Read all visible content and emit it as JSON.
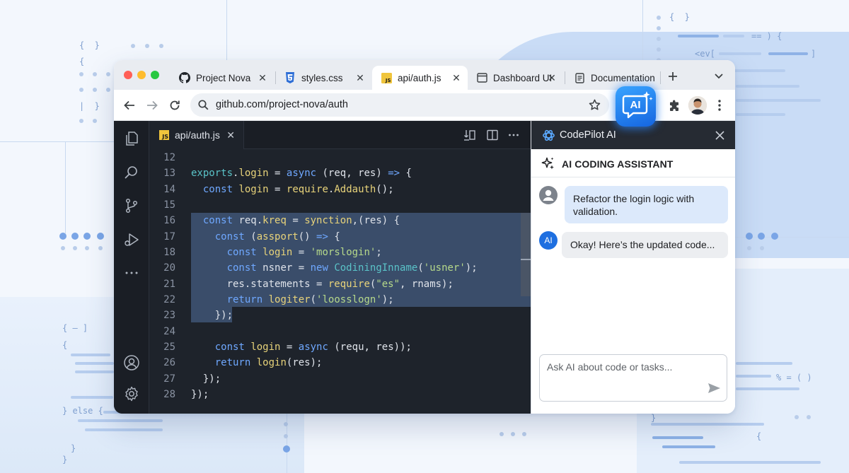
{
  "browser": {
    "tabs": [
      {
        "label": "Project Nova",
        "icon": "github-icon",
        "active": false
      },
      {
        "label": "styles.css",
        "icon": "css-icon",
        "active": false
      },
      {
        "label": "api/auth.js",
        "icon": "js-icon",
        "active": true
      },
      {
        "label": "Dashboard UI",
        "icon": "window-icon",
        "active": false
      },
      {
        "label": "Documentation",
        "icon": "document-icon",
        "active": false
      }
    ],
    "url": "github.com/project-nova/auth",
    "ai_badge_label": "AI"
  },
  "editor": {
    "tab_label": "api/auth.js",
    "js_badge": "JS",
    "lines": [
      {
        "n": "12",
        "tokens": []
      },
      {
        "n": "13",
        "tokens": [
          [
            "t",
            "exports"
          ],
          [
            "p",
            "."
          ],
          [
            "f",
            "login"
          ],
          [
            "p",
            " = "
          ],
          [
            "k",
            "async"
          ],
          [
            "p",
            " (req, res) "
          ],
          [
            "k",
            "=>"
          ],
          [
            "p",
            " {"
          ]
        ]
      },
      {
        "n": "14",
        "tokens": [
          [
            "p",
            "  "
          ],
          [
            "k",
            "const"
          ],
          [
            "p",
            " "
          ],
          [
            "f",
            "login"
          ],
          [
            "p",
            " = "
          ],
          [
            "f",
            "require"
          ],
          [
            "p",
            "."
          ],
          [
            "f",
            "Addauth"
          ],
          [
            "p",
            "();"
          ]
        ]
      },
      {
        "n": "15",
        "tokens": []
      },
      {
        "n": "16",
        "tokens": [
          [
            "p",
            "  "
          ],
          [
            "k",
            "const"
          ],
          [
            "p",
            " req."
          ],
          [
            "f",
            "kreq"
          ],
          [
            "p",
            " = "
          ],
          [
            "f",
            "synction"
          ],
          [
            "p",
            ",(res) {"
          ]
        ]
      },
      {
        "n": "17",
        "tokens": [
          [
            "p",
            "    "
          ],
          [
            "k",
            "const"
          ],
          [
            "p",
            " ("
          ],
          [
            "f",
            "assport"
          ],
          [
            "p",
            "() "
          ],
          [
            "k",
            "=>"
          ],
          [
            "p",
            " {"
          ]
        ]
      },
      {
        "n": "18",
        "tokens": [
          [
            "p",
            "      "
          ],
          [
            "k",
            "const"
          ],
          [
            "p",
            " "
          ],
          [
            "f",
            "login"
          ],
          [
            "p",
            " = "
          ],
          [
            "s",
            "'morslogin'"
          ],
          [
            "p",
            ";"
          ]
        ]
      },
      {
        "n": "20",
        "tokens": [
          [
            "p",
            "      "
          ],
          [
            "k",
            "const"
          ],
          [
            "p",
            " nsner = "
          ],
          [
            "k",
            "new"
          ],
          [
            "p",
            " "
          ],
          [
            "t",
            "CodiningInname"
          ],
          [
            "p",
            "("
          ],
          [
            "s",
            "'usner'"
          ],
          [
            "p",
            ");"
          ]
        ]
      },
      {
        "n": "21",
        "tokens": [
          [
            "p",
            "      res.statements = "
          ],
          [
            "f",
            "require"
          ],
          [
            "p",
            "("
          ],
          [
            "s",
            "\"es\""
          ],
          [
            "p",
            ", rnams);"
          ]
        ]
      },
      {
        "n": "22",
        "tokens": [
          [
            "p",
            "      "
          ],
          [
            "k",
            "return"
          ],
          [
            "p",
            " "
          ],
          [
            "f",
            "logiter"
          ],
          [
            "p",
            "("
          ],
          [
            "s",
            "'loosslogn'"
          ],
          [
            "p",
            ");"
          ]
        ]
      },
      {
        "n": "23",
        "tokens": [
          [
            "p",
            "    });"
          ]
        ]
      },
      {
        "n": "24",
        "tokens": []
      },
      {
        "n": "25",
        "tokens": [
          [
            "p",
            "    "
          ],
          [
            "k",
            "const"
          ],
          [
            "p",
            " "
          ],
          [
            "f",
            "login"
          ],
          [
            "p",
            " = "
          ],
          [
            "k",
            "async"
          ],
          [
            "p",
            " (requ, res));"
          ]
        ]
      },
      {
        "n": "26",
        "tokens": [
          [
            "p",
            "    "
          ],
          [
            "k",
            "return"
          ],
          [
            "p",
            " "
          ],
          [
            "f",
            "login"
          ],
          [
            "p",
            "(res);"
          ]
        ]
      },
      {
        "n": "27",
        "tokens": [
          [
            "p",
            "  });"
          ]
        ]
      },
      {
        "n": "28",
        "tokens": [
          [
            "p",
            "});"
          ]
        ]
      }
    ]
  },
  "assistant": {
    "title": "CodePilot AI",
    "subtitle": "AI CODING ASSISTANT",
    "messages": [
      {
        "role": "user",
        "text": "Refactor the login logic with validation."
      },
      {
        "role": "ai",
        "avatar": "AI",
        "text": "Okay! Here’s the updated code..."
      }
    ],
    "input_placeholder": "Ask AI about code or tasks..."
  },
  "background_code": {
    "braces_top": "{  }",
    "braces_top2": "{",
    "pipe": "|  }",
    "left_mid": "{ — ]",
    "left_mid2": "{",
    "else": "} else {",
    "close1": "}",
    "close2": "}",
    "right_top": "{  }",
    "right_eq": "== ) {",
    "right_ev": "<ev[",
    "right_bracket": "]",
    "right_fn": "% = ( )",
    "right_bottom": "}",
    "right_bottom2": "{"
  }
}
